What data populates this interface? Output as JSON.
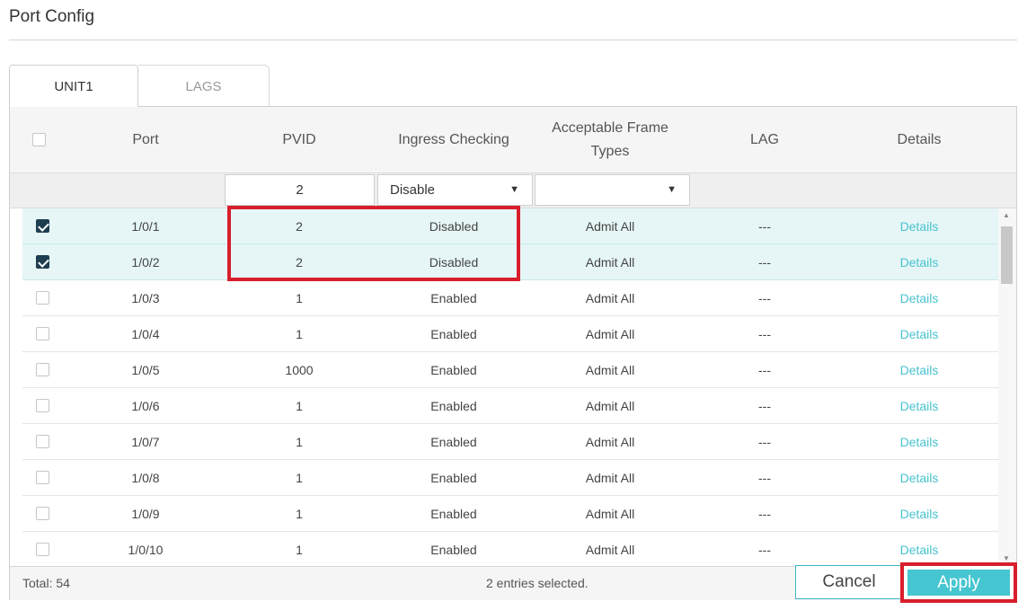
{
  "page": {
    "title": "Port Config"
  },
  "tabs": [
    {
      "label": "UNIT1",
      "active": true
    },
    {
      "label": "LAGS",
      "active": false
    }
  ],
  "columns": {
    "port": "Port",
    "pvid": "PVID",
    "ingress": "Ingress Checking",
    "frame_types": "Acceptable Frame Types",
    "lag": "LAG",
    "details": "Details"
  },
  "filter": {
    "pvid_value": "2",
    "ingress_value": "Disable",
    "frame_types_value": ""
  },
  "rows": [
    {
      "selected": true,
      "port": "1/0/1",
      "pvid": "2",
      "ingress": "Disabled",
      "frame_types": "Admit All",
      "lag": "---",
      "details": "Details"
    },
    {
      "selected": true,
      "port": "1/0/2",
      "pvid": "2",
      "ingress": "Disabled",
      "frame_types": "Admit All",
      "lag": "---",
      "details": "Details"
    },
    {
      "selected": false,
      "port": "1/0/3",
      "pvid": "1",
      "ingress": "Enabled",
      "frame_types": "Admit All",
      "lag": "---",
      "details": "Details"
    },
    {
      "selected": false,
      "port": "1/0/4",
      "pvid": "1",
      "ingress": "Enabled",
      "frame_types": "Admit All",
      "lag": "---",
      "details": "Details"
    },
    {
      "selected": false,
      "port": "1/0/5",
      "pvid": "1000",
      "ingress": "Enabled",
      "frame_types": "Admit All",
      "lag": "---",
      "details": "Details"
    },
    {
      "selected": false,
      "port": "1/0/6",
      "pvid": "1",
      "ingress": "Enabled",
      "frame_types": "Admit All",
      "lag": "---",
      "details": "Details"
    },
    {
      "selected": false,
      "port": "1/0/7",
      "pvid": "1",
      "ingress": "Enabled",
      "frame_types": "Admit All",
      "lag": "---",
      "details": "Details"
    },
    {
      "selected": false,
      "port": "1/0/8",
      "pvid": "1",
      "ingress": "Enabled",
      "frame_types": "Admit All",
      "lag": "---",
      "details": "Details"
    },
    {
      "selected": false,
      "port": "1/0/9",
      "pvid": "1",
      "ingress": "Enabled",
      "frame_types": "Admit All",
      "lag": "---",
      "details": "Details"
    },
    {
      "selected": false,
      "port": "1/0/10",
      "pvid": "1",
      "ingress": "Enabled",
      "frame_types": "Admit All",
      "lag": "---",
      "details": "Details"
    }
  ],
  "footer": {
    "total": "Total: 54",
    "selection": "2 entries selected."
  },
  "buttons": {
    "cancel": "Cancel",
    "apply": "Apply"
  },
  "colors": {
    "accent": "#46c6d1",
    "highlight": "#d81e2c",
    "selected_row": "#e6f6f6",
    "checkbox_checked": "#1e3d50",
    "link": "#48c3cf"
  }
}
